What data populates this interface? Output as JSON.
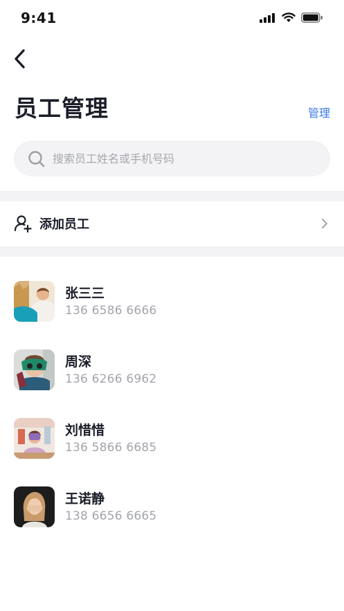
{
  "status_bar": {
    "time": "9:41"
  },
  "header": {
    "title": "员工管理",
    "manage_label": "管理"
  },
  "search": {
    "placeholder": "搜索员工姓名或手机号码"
  },
  "add_employee": {
    "label": "添加员工"
  },
  "employees": [
    {
      "name": "张三三",
      "phone": "136 6586 6666"
    },
    {
      "name": "周深",
      "phone": "136 6266 6962"
    },
    {
      "name": "刘惜惜",
      "phone": "136 5866 6685"
    },
    {
      "name": "王诺静",
      "phone": "138 6656 6665"
    }
  ],
  "colors": {
    "accent": "#3a78e6",
    "text_primary": "#1b1d28",
    "text_secondary": "#a3a5ab",
    "band": "#f3f3f5"
  },
  "icons": [
    "back-arrow-icon",
    "search-icon",
    "add-user-icon",
    "chevron-right-icon",
    "signal-icon",
    "wifi-icon",
    "battery-icon"
  ]
}
